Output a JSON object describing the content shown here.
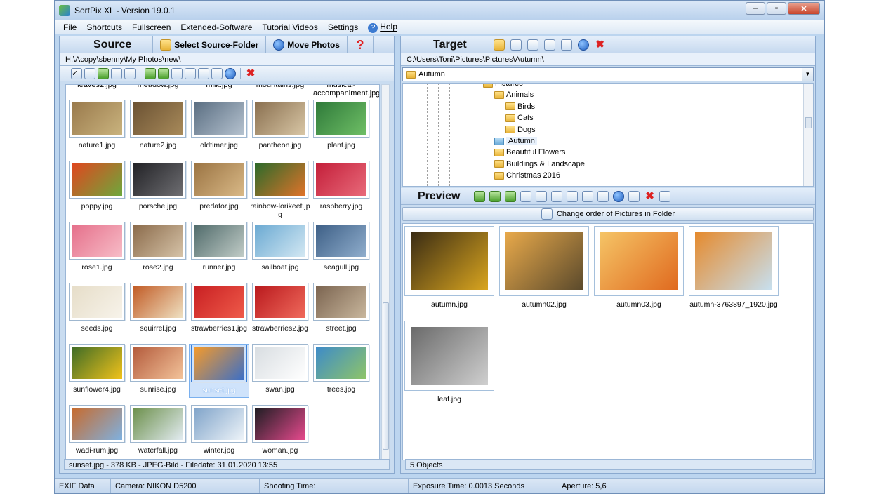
{
  "window": {
    "title": "SortPix XL - Version 19.0.1"
  },
  "menu": [
    "File",
    "Shortcuts",
    "Fullscreen",
    "Extended-Software",
    "Tutorial Videos",
    "Settings",
    "Help"
  ],
  "source": {
    "title": "Source",
    "select_folder": "Select Source-Folder",
    "move_photos": "Move Photos",
    "path": "H:\\Acopy\\sbenny\\My Photos\\new\\",
    "partial_row": [
      "leaves2.jpg",
      "meadow.jpg",
      "milk.jpg",
      "mountains.jpg",
      "musical-accompaniment.jpg"
    ],
    "thumbnails": [
      {
        "name": "nature1.jpg",
        "c1": "#9a7a4c",
        "c2": "#c9b37e"
      },
      {
        "name": "nature2.jpg",
        "c1": "#6b5233",
        "c2": "#a88a5a"
      },
      {
        "name": "oldtimer.jpg",
        "c1": "#5a6e82",
        "c2": "#b5c2cf"
      },
      {
        "name": "pantheon.jpg",
        "c1": "#8a7050",
        "c2": "#d8c6a5"
      },
      {
        "name": "plant.jpg",
        "c1": "#2f7a3a",
        "c2": "#6fbf66"
      },
      {
        "name": "poppy.jpg",
        "c1": "#e0461e",
        "c2": "#6da83c"
      },
      {
        "name": "porsche.jpg",
        "c1": "#222226",
        "c2": "#6e6e72"
      },
      {
        "name": "predator.jpg",
        "c1": "#9b7443",
        "c2": "#d9b987"
      },
      {
        "name": "rainbow-lorikeet.jpg",
        "c1": "#2c6a2a",
        "c2": "#e0732a"
      },
      {
        "name": "raspberry.jpg",
        "c1": "#c41f3a",
        "c2": "#e86a7a"
      },
      {
        "name": "rose1.jpg",
        "c1": "#e56f8a",
        "c2": "#f7bcc7"
      },
      {
        "name": "rose2.jpg",
        "c1": "#8a6a4a",
        "c2": "#d6c3a8"
      },
      {
        "name": "runner.jpg",
        "c1": "#4f6a6a",
        "c2": "#c1ccc7"
      },
      {
        "name": "sailboat.jpg",
        "c1": "#6aa9d2",
        "c2": "#d3e8f3"
      },
      {
        "name": "seagull.jpg",
        "c1": "#3d5f86",
        "c2": "#90aecd"
      },
      {
        "name": "seeds.jpg",
        "c1": "#e6ddc8",
        "c2": "#f7f3ea"
      },
      {
        "name": "squirrel.jpg",
        "c1": "#c15a24",
        "c2": "#efe1c2"
      },
      {
        "name": "strawberries1.jpg",
        "c1": "#c81f22",
        "c2": "#ef5b4a"
      },
      {
        "name": "strawberries2.jpg",
        "c1": "#b9191d",
        "c2": "#f06a5c"
      },
      {
        "name": "street.jpg",
        "c1": "#7b6450",
        "c2": "#c9b79d"
      },
      {
        "name": "sunflower4.jpg",
        "c1": "#3d6b26",
        "c2": "#f1c21b"
      },
      {
        "name": "sunrise.jpg",
        "c1": "#b35a3b",
        "c2": "#f3c39a"
      },
      {
        "name": "sunset.jpg",
        "c1": "#f59a2a",
        "c2": "#3b6fc7"
      },
      {
        "name": "swan.jpg",
        "c1": "#d8dde1",
        "c2": "#ffffff"
      },
      {
        "name": "trees.jpg",
        "c1": "#3d8bc9",
        "c2": "#8fc568"
      },
      {
        "name": "wadi-rum.jpg",
        "c1": "#c86a2c",
        "c2": "#7fb1e0"
      },
      {
        "name": "waterfall.jpg",
        "c1": "#6b8f4a",
        "c2": "#e3ecf2"
      },
      {
        "name": "winter.jpg",
        "c1": "#7fa3c9",
        "c2": "#eef4f9"
      },
      {
        "name": "woman.jpg",
        "c1": "#1d1d22",
        "c2": "#e74a8e"
      }
    ],
    "selected": "sunset.jpg",
    "status": "sunset.jpg - 378 KB - JPEG-Bild - Filedate: 31.01.2020 13:55"
  },
  "target": {
    "title": "Target",
    "path": "C:\\Users\\Toni\\Pictures\\Pictures\\Autumn\\",
    "combo": "Autumn",
    "tree": [
      {
        "label": "Pictures",
        "level": 0
      },
      {
        "label": "Animals",
        "level": 1
      },
      {
        "label": "Birds",
        "level": 2
      },
      {
        "label": "Cats",
        "level": 2
      },
      {
        "label": "Dogs",
        "level": 2
      },
      {
        "label": "Autumn",
        "level": 1,
        "selected": true
      },
      {
        "label": "Beautiful Flowers",
        "level": 1
      },
      {
        "label": "Buildings & Landscape",
        "level": 1
      },
      {
        "label": "Christmas 2016",
        "level": 1
      }
    ],
    "preview_title": "Preview",
    "reorder": "Change order of Pictures in Folder",
    "previews": [
      {
        "name": "autumn.jpg",
        "c1": "#3a2c14",
        "c2": "#d9a51f"
      },
      {
        "name": "autumn02.jpg",
        "c1": "#e8a94a",
        "c2": "#5b4a2c"
      },
      {
        "name": "autumn03.jpg",
        "c1": "#f5c466",
        "c2": "#e06a1f"
      },
      {
        "name": "autumn-3763897_1920.jpg",
        "c1": "#e58a2d",
        "c2": "#c7e0f0"
      },
      {
        "name": "leaf.jpg",
        "c1": "#6a6a6a",
        "c2": "#cfcfcf"
      }
    ],
    "status": "5 Objects"
  },
  "exif": {
    "label": "EXIF Data",
    "camera": "Camera: NIKON D5200",
    "shooting": "Shooting Time:",
    "exposure": "Exposure Time: 0.0013 Seconds",
    "aperture": "Aperture: 5,6"
  }
}
